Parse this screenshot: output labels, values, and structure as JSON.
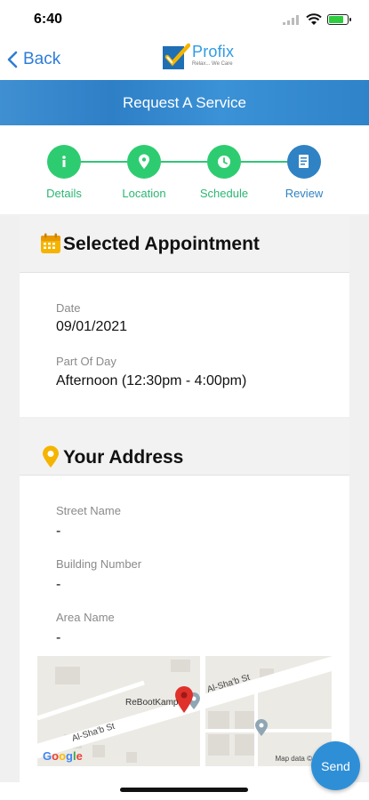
{
  "status_bar": {
    "time": "6:40"
  },
  "nav": {
    "back_label": "Back"
  },
  "logo": {
    "name": "Profix",
    "tagline": "Relax... We Care"
  },
  "header": {
    "title": "Request A Service"
  },
  "steps": [
    {
      "label": "Details",
      "icon": "info-icon"
    },
    {
      "label": "Location",
      "icon": "location-pin-icon"
    },
    {
      "label": "Schedule",
      "icon": "clock-icon"
    },
    {
      "label": "Review",
      "icon": "document-icon"
    }
  ],
  "appointment": {
    "title": "Selected Appointment",
    "date_label": "Date",
    "date_value": "09/01/2021",
    "part_label": "Part Of Day",
    "part_value": "Afternoon (12:30pm - 4:00pm)"
  },
  "address": {
    "title": "Your Address",
    "street_label": "Street Name",
    "street_value": "-",
    "building_label": "Building Number",
    "building_value": "-",
    "area_label": "Area Name",
    "area_value": "-"
  },
  "map": {
    "street_1": "Al-Sha'b St",
    "street_2": "Al-Sha'b St",
    "place": "ReBootKamp",
    "google": "Google",
    "credit": "Map data ©"
  },
  "send_label": "Send",
  "colors": {
    "primary": "#2f82c3",
    "green": "#2ecc71",
    "accent_yellow": "#f5b400"
  }
}
